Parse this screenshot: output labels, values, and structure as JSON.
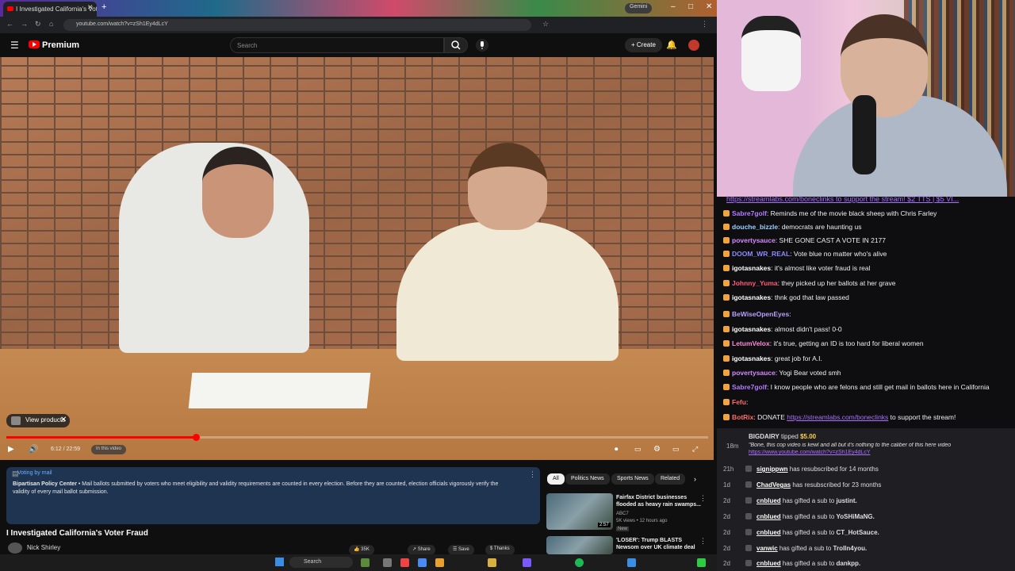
{
  "browser": {
    "tab_title": "I Investigated California's Voter",
    "tab_close": "✕",
    "new_tab": "+",
    "gemini_label": "Gemini",
    "url": "youtube.com/watch?v=zSh1Ey4dLcY"
  },
  "youtube": {
    "logo_text": "Premium",
    "search_placeholder": "Search",
    "create_label": "Create"
  },
  "player": {
    "view_products": "View products",
    "time": "6:12 / 22:59",
    "in_this_video": "In this video",
    "progress": 0.27
  },
  "info_panel": {
    "title": "Voting by mail",
    "body_source": "Bipartisan Policy Center",
    "body": " • Mail ballots submitted by voters who meet eligibility and validity requirements are counted in every election. Before they are counted, election officials vigorously verify the validity of every mail ballot submission."
  },
  "video": {
    "title": "I Investigated California's Voter Fraud",
    "channel": "Nick Shirley",
    "likes": "35K",
    "share": "Share",
    "save": "Save",
    "thanks": "Thanks"
  },
  "rail": {
    "chips": [
      "All",
      "Politics News",
      "Sports News",
      "Related"
    ],
    "items": [
      {
        "title": "Fairfax District businesses flooded as heavy rain swamps...",
        "channel": "ABC7",
        "meta": "5K views • 12 hours ago",
        "badge": "New",
        "duration": "2:57"
      },
      {
        "title": "'LOSER': Trump BLASTS Newsom over UK climate deal",
        "channel": "",
        "meta": "",
        "badge": "",
        "duration": ""
      }
    ]
  },
  "taskbar": {
    "search_label": "Search"
  },
  "chat": {
    "pinned": "https://streamlabs.com/boneclinks to support the stream! $2 TTS | $5 VI...",
    "messages": [
      {
        "user": "Sabre7golf",
        "color": "#b57dff",
        "text": ": Reminds me of the movie black sheep with Chris Farley"
      },
      {
        "user": "douche_bizzle",
        "color": "#9ad0ff",
        "text": ": democrats are haunting us"
      },
      {
        "user": "povertysauce",
        "color": "#d58aff",
        "text": ": SHE GONE CAST A VOTE IN 2177"
      },
      {
        "user": "DOOM_WR_REAL",
        "color": "#8a8aff",
        "text": ": Vote blue no matter who's alive"
      },
      {
        "user": "igotasnakes",
        "color": "#ffffff",
        "text": ": it's almost like voter fraud is real"
      },
      {
        "user": "Johnny_Yuma",
        "color": "#ff5a7a",
        "text": ": they picked up her ballots at her grave"
      },
      {
        "user": "igotasnakes",
        "color": "#ffffff",
        "text": ": thnk god that law passed"
      },
      {
        "user": "BeWiseOpenEyes",
        "color": "#b8a0ff",
        "text": ":"
      },
      {
        "user": "igotasnakes",
        "color": "#ffffff",
        "text": ": almost didn't pass! 0-0"
      },
      {
        "user": "LetumVelox",
        "color": "#ff8ad8",
        "text": ": it's true, getting an ID is too hard for liberal women"
      },
      {
        "user": "igotasnakes",
        "color": "#ffffff",
        "text": ": great job for A.I."
      },
      {
        "user": "povertysauce",
        "color": "#d58aff",
        "text": ": Yogi Bear voted smh"
      },
      {
        "user": "Sabre7golf",
        "color": "#b57dff",
        "text": ": I know people who are felons and still get mail in ballots here in California"
      },
      {
        "user": "Fefu",
        "color": "#ff6a6a",
        "text": ":"
      },
      {
        "user": "BotRix",
        "color": "#ff6a6a",
        "text": ": DONATE ",
        "link": "https://streamlabs.com/boneclinks",
        "tail": " to support the stream!"
      }
    ]
  },
  "events": {
    "tip": {
      "user": "BIGDAIRY",
      "text": " tipped ",
      "amount": "$5.00",
      "time": "18m",
      "quote": "\"Bone, this cop video is kewl and all but it's nothing to the caliber of this here video",
      "quote_link": "https://www.youtube.com/watch?v=zSh1Ey4dLcY"
    },
    "items": [
      {
        "time": "21h",
        "user": "signippwn",
        "text": " has resubscribed for 14 months"
      },
      {
        "time": "1d",
        "user": "ChadVegas",
        "text": " has resubscribed for 23 months"
      },
      {
        "time": "2d",
        "user": "cnblued",
        "text": " has gifted a sub to ",
        "target": "justint."
      },
      {
        "time": "2d",
        "user": "cnblued",
        "text": " has gifted a sub to ",
        "target": "YoSHiMaNG."
      },
      {
        "time": "2d",
        "user": "cnblued",
        "text": " has gifted a sub to ",
        "target": "CT_HotSauce."
      },
      {
        "time": "2d",
        "user": "vanwic",
        "text": " has gifted a sub to ",
        "target": "Trolln4you."
      },
      {
        "time": "2d",
        "user": "cnblued",
        "text": " has gifted a sub to ",
        "target": "dankpp."
      }
    ]
  }
}
